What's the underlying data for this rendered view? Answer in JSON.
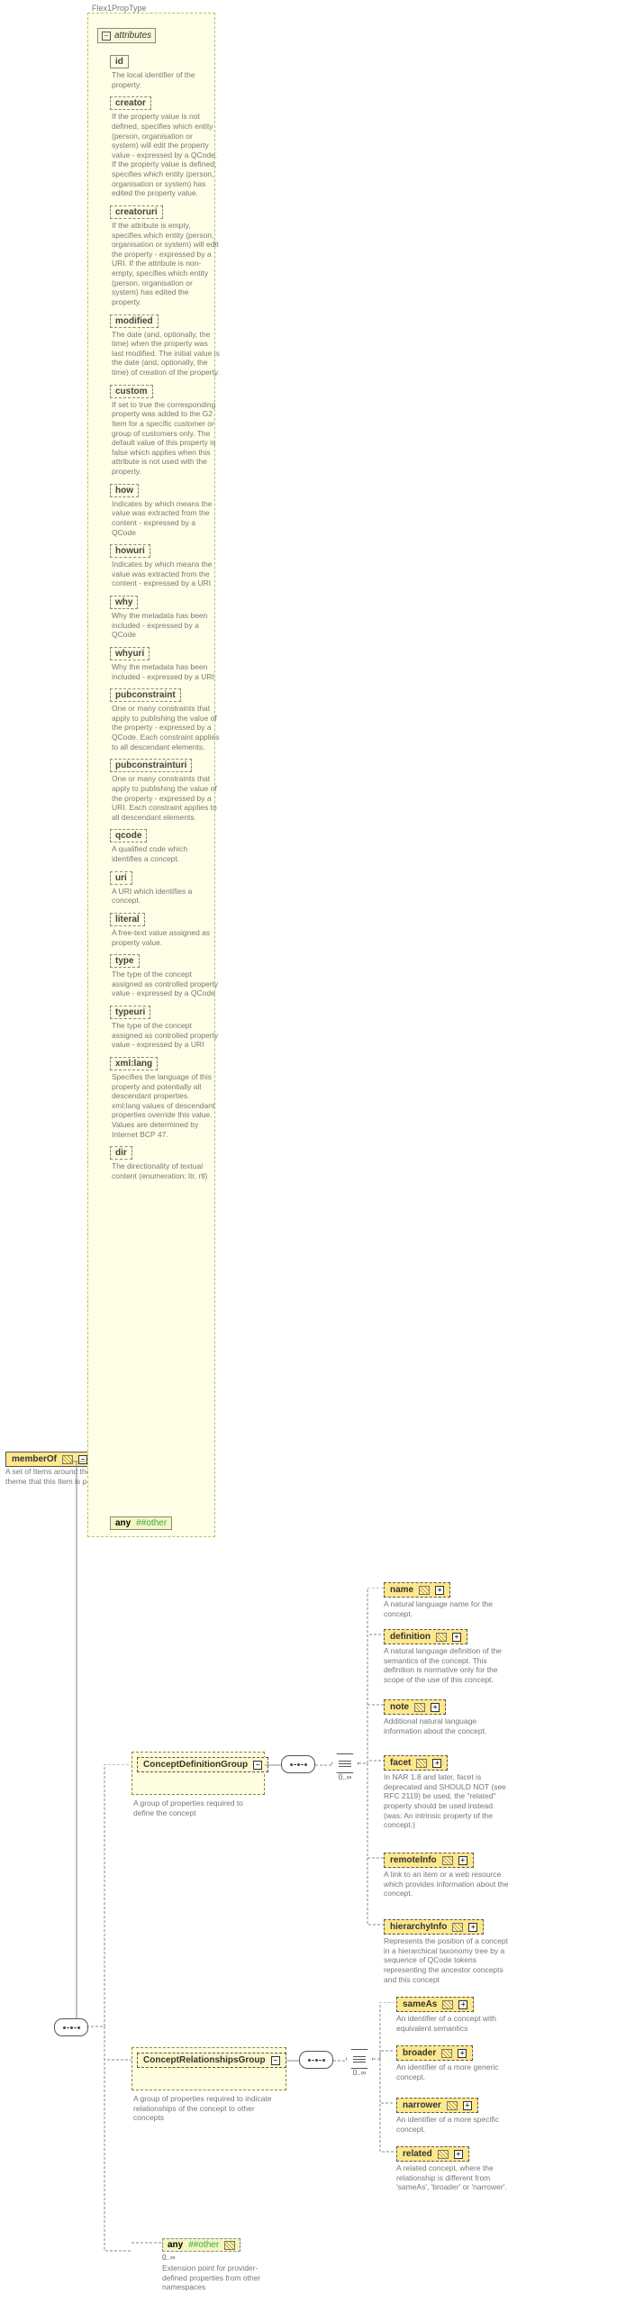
{
  "typeLabel": "Flex1PropType",
  "attributesHeader": "attributes",
  "root": {
    "name": "memberOf",
    "desc": "A set of Items around the same theme that this Item is part of."
  },
  "attrs": [
    {
      "name": "id",
      "solid": true,
      "desc": "The local identifier of the property."
    },
    {
      "name": "creator",
      "desc": "If the property value is not defined, specifies which entity (person, organisation or system) will edit the property value - expressed by a QCode. If the property value is defined, specifies which entity (person, organisation or system) has edited the property value."
    },
    {
      "name": "creatoruri",
      "desc": "If the attribute is empty, specifies which entity (person, organisation or system) will edit the property - expressed by a URI. If the attribute is non-empty, specifies which entity (person, organisation or system) has edited the property."
    },
    {
      "name": "modified",
      "desc": "The date (and, optionally, the time) when the property was last modified. The initial value is the date (and, optionally, the time) of creation of the property."
    },
    {
      "name": "custom",
      "desc": "If set to true the corresponding property was added to the G2 Item for a specific customer or group of customers only. The default value of this property is false which applies when this attribute is not used with the property."
    },
    {
      "name": "how",
      "desc": "Indicates by which means the value was extracted from the content - expressed by a QCode"
    },
    {
      "name": "howuri",
      "desc": "Indicates by which means the value was extracted from the content - expressed by a URI"
    },
    {
      "name": "why",
      "desc": "Why the metadata has been included - expressed by a QCode"
    },
    {
      "name": "whyuri",
      "desc": "Why the metadata has been included - expressed by a URI"
    },
    {
      "name": "pubconstraint",
      "desc": "One or many constraints that apply to publishing the value of the property - expressed by a QCode. Each constraint applies to all descendant elements."
    },
    {
      "name": "pubconstrainturi",
      "desc": "One or many constraints that apply to publishing the value of the property - expressed by a URI. Each constraint applies to all descendant elements."
    },
    {
      "name": "qcode",
      "desc": "A qualified code which identifies a concept."
    },
    {
      "name": "uri",
      "desc": "A URI which identifies a concept."
    },
    {
      "name": "literal",
      "desc": "A free-text value assigned as property value."
    },
    {
      "name": "type",
      "desc": "The type of the concept assigned as controlled property value - expressed by a QCode"
    },
    {
      "name": "typeuri",
      "desc": "The type of the concept assigned as controlled property value - expressed by a URI"
    },
    {
      "name": "xml:lang",
      "desc": "Specifies the language of this property and potentially all descendant properties. xml:lang values of descendant properties override this value. Values are determined by Internet BCP 47."
    },
    {
      "name": "dir",
      "desc": "The directionality of textual content (enumeration: ltr, rtl)"
    }
  ],
  "anyOther": {
    "label1": "any",
    "label2": "##other"
  },
  "groups": {
    "definition": {
      "name": "ConceptDefinitionGroup",
      "desc": "A group of properties required to define the concept"
    },
    "relationships": {
      "name": "ConceptRelationshipsGroup",
      "desc": "A group of properties required to indicate relationships of the concept to other concepts"
    }
  },
  "defChildren": [
    {
      "name": "name",
      "desc": "A natural language name for the concept."
    },
    {
      "name": "definition",
      "desc": "A natural language definition of the semantics of the concept. This definition is normative only for the scope of the use of this concept."
    },
    {
      "name": "note",
      "desc": "Additional natural language information about the concept."
    },
    {
      "name": "facet",
      "desc": "In NAR 1.8 and later, facet is deprecated and SHOULD NOT (see RFC 2119) be used, the \"related\" property should be used instead. (was: An intrinsic property of the concept.)"
    },
    {
      "name": "remoteInfo",
      "desc": "A link to an item or a web resource which provides information about the concept."
    },
    {
      "name": "hierarchyInfo",
      "desc": "Represents the position of a concept in a hierarchical taxonomy tree by a sequence of QCode tokens representing the ancestor concepts and this concept"
    }
  ],
  "relChildren": [
    {
      "name": "sameAs",
      "desc": "An identifier of a concept with equivalent semantics"
    },
    {
      "name": "broader",
      "desc": "An identifier of a more generic concept."
    },
    {
      "name": "narrower",
      "desc": "An identifier of a more specific concept."
    },
    {
      "name": "related",
      "desc": "A related concept, where the relationship is different from 'sameAs', 'broader' or 'narrower'."
    }
  ],
  "extAny": {
    "label1": "any",
    "label2": "##other",
    "desc": "Extension point for provider-defined properties from other namespaces"
  },
  "inftyLabel": "0..∞"
}
